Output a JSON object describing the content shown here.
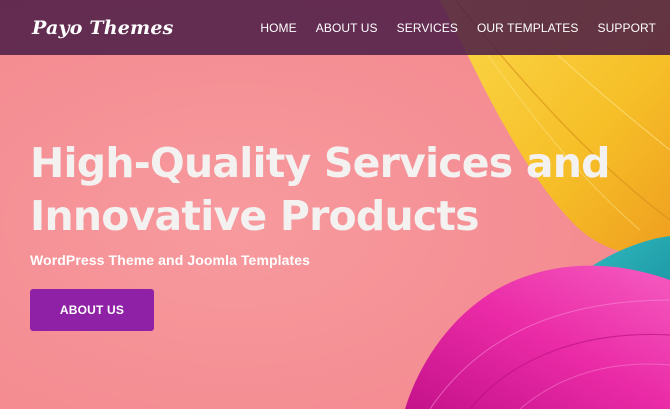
{
  "brand": {
    "logo_text": "Payo Themes"
  },
  "nav": {
    "items": [
      {
        "label": "HOME"
      },
      {
        "label": "ABOUT US"
      },
      {
        "label": "SERVICES"
      },
      {
        "label": "OUR TEMPLATES"
      },
      {
        "label": "SUPPORT"
      }
    ]
  },
  "hero": {
    "headline_line1": "High-Quality Services and",
    "headline_line2": "Innovative Products",
    "subtitle": "WordPress Theme and Joomla Templates",
    "cta_label": "ABOUT US"
  },
  "colors": {
    "background": "#f48f94",
    "topbar": "#4a1c46",
    "cta": "#8e21a6",
    "feather_yellow": "#f7c531",
    "feather_magenta": "#e0209c",
    "feather_teal": "#1fa8b3"
  }
}
